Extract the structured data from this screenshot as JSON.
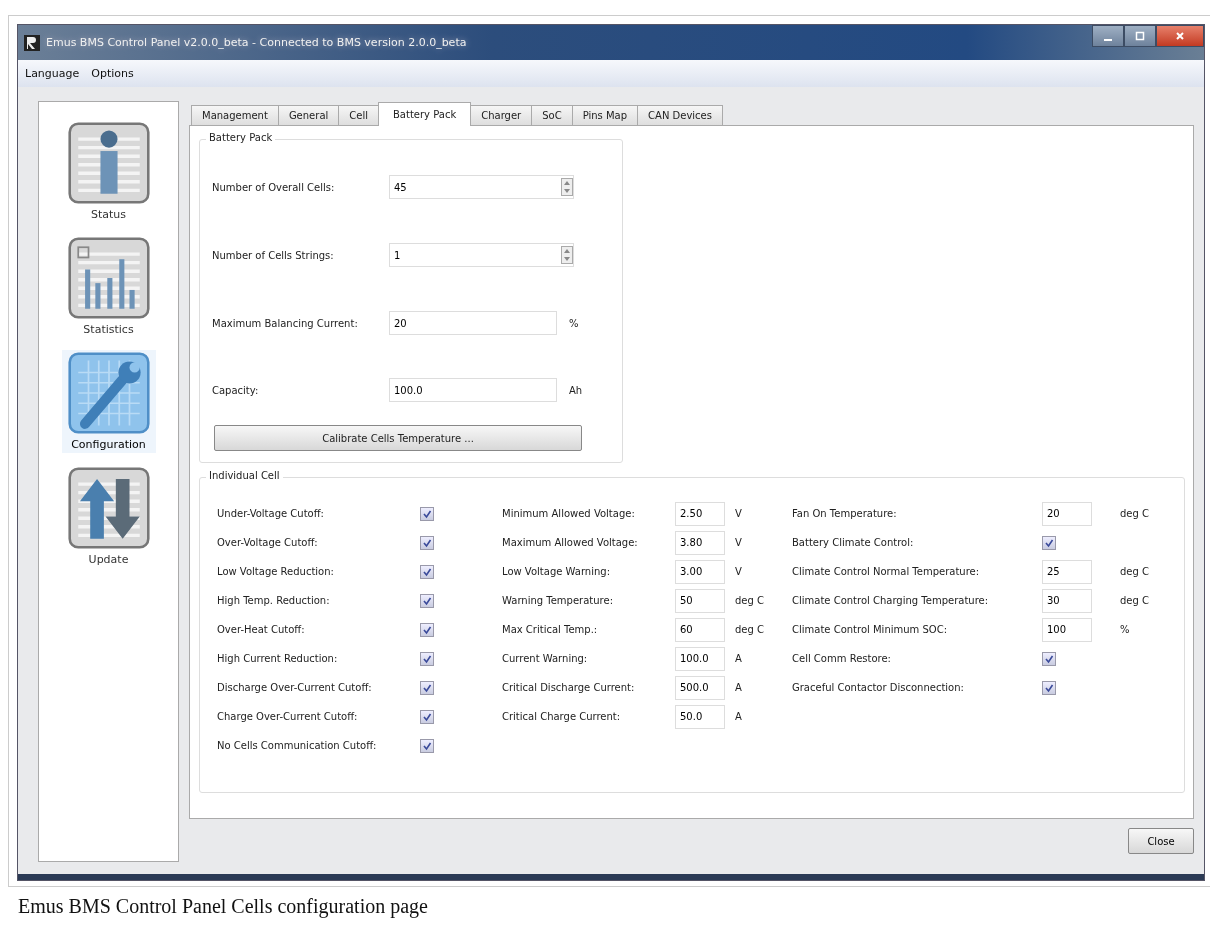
{
  "window": {
    "title": "Emus BMS Control Panel v2.0.0_beta - Connected to BMS version 2.0.0_beta"
  },
  "menu": [
    "Language",
    "Options"
  ],
  "sidebar": {
    "items": [
      {
        "label": "Status",
        "kind": "info",
        "selected": false
      },
      {
        "label": "Statistics",
        "kind": "stats",
        "selected": false
      },
      {
        "label": "Configuration",
        "kind": "config",
        "selected": true
      },
      {
        "label": "Update",
        "kind": "update",
        "selected": false
      }
    ]
  },
  "tabs": [
    {
      "label": "Management",
      "selected": false
    },
    {
      "label": "General",
      "selected": false
    },
    {
      "label": "Cell",
      "selected": false
    },
    {
      "label": "Battery Pack",
      "selected": true
    },
    {
      "label": "Charger",
      "selected": false
    },
    {
      "label": "SoC",
      "selected": false
    },
    {
      "label": "Pins Map",
      "selected": false
    },
    {
      "label": "CAN Devices",
      "selected": false
    }
  ],
  "battery_pack": {
    "title": "Battery Pack",
    "fields": [
      {
        "kind": "spin",
        "label": "Number of Overall Cells:",
        "value": "45"
      },
      {
        "kind": "spin",
        "label": "Number of Cells Strings:",
        "value": "1"
      },
      {
        "kind": "text",
        "label": "Maximum Balancing Current:",
        "value": "20",
        "unit": "%"
      },
      {
        "kind": "text",
        "label": "Capacity:",
        "value": "100.0",
        "unit": "Ah"
      }
    ],
    "button": "Calibrate Cells Temperature ..."
  },
  "individual_cell": {
    "title": "Individual Cell",
    "columns": [
      [
        {
          "kind": "check",
          "label": "Under-Voltage Cutoff:",
          "checked": true
        },
        {
          "kind": "check",
          "label": "Over-Voltage Cutoff:",
          "checked": true
        },
        {
          "kind": "check",
          "label": "Low Voltage Reduction:",
          "checked": true
        },
        {
          "kind": "check",
          "label": "High Temp. Reduction:",
          "checked": true
        },
        {
          "kind": "check",
          "label": "Over-Heat Cutoff:",
          "checked": true
        },
        {
          "kind": "check",
          "label": "High Current Reduction:",
          "checked": true
        },
        {
          "kind": "check",
          "label": "Discharge Over-Current Cutoff:",
          "checked": true
        },
        {
          "kind": "check",
          "label": "Charge Over-Current Cutoff:",
          "checked": true
        },
        {
          "kind": "check",
          "label": "No Cells Communication Cutoff:",
          "checked": true
        }
      ],
      [
        {
          "kind": "value",
          "label": "Minimum Allowed Voltage:",
          "value": "2.50",
          "unit": "V"
        },
        {
          "kind": "value",
          "label": "Maximum Allowed Voltage:",
          "value": "3.80",
          "unit": "V"
        },
        {
          "kind": "value",
          "label": "Low Voltage Warning:",
          "value": "3.00",
          "unit": "V"
        },
        {
          "kind": "value",
          "label": "Warning Temperature:",
          "value": "50",
          "unit": "deg C"
        },
        {
          "kind": "value",
          "label": "Max Critical Temp.:",
          "value": "60",
          "unit": "deg C"
        },
        {
          "kind": "value",
          "label": "Current Warning:",
          "value": "100.0",
          "unit": "A"
        },
        {
          "kind": "value",
          "label": "Critical Discharge Current:",
          "value": "500.0",
          "unit": "A"
        },
        {
          "kind": "value",
          "label": "Critical Charge Current:",
          "value": "50.0",
          "unit": "A"
        }
      ],
      [
        {
          "kind": "value",
          "label": "Fan On Temperature:",
          "value": "20",
          "unit": "deg C"
        },
        {
          "kind": "check",
          "label": "Battery Climate Control:",
          "checked": true
        },
        {
          "kind": "value",
          "label": "Climate Control Normal Temperature:",
          "value": "25",
          "unit": "deg C"
        },
        {
          "kind": "value",
          "label": "Climate Control Charging Temperature:",
          "value": "30",
          "unit": "deg C"
        },
        {
          "kind": "value",
          "label": "Climate Control Minimum SOC:",
          "value": "100",
          "unit": "%"
        },
        {
          "kind": "check",
          "label": "Cell Comm Restore:",
          "checked": true
        },
        {
          "kind": "check",
          "label": "Graceful Contactor Disconnection:",
          "checked": true
        }
      ]
    ]
  },
  "close_button": "Close",
  "caption": "Emus BMS Control Panel Cells configuration page"
}
